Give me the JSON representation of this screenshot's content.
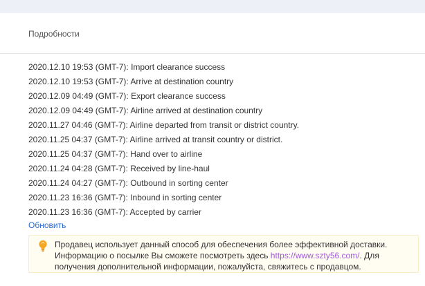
{
  "details": {
    "title": "Подробности"
  },
  "events": [
    "2020.12.10 19:53 (GMT-7): Import clearance success",
    "2020.12.10 19:53 (GMT-7): Arrive at destination country",
    "2020.12.09 04:49 (GMT-7): Export clearance success",
    "2020.12.09 04:49 (GMT-7): Airline arrived at destination country",
    "2020.11.27 04:46 (GMT-7): Airline departed from transit or district country.",
    "2020.11.25 04:37 (GMT-7): Airline arrived at transit country or district.",
    "2020.11.25 04:37 (GMT-7): Hand over to airline",
    "2020.11.24 04:28 (GMT-7): Received by line-haul",
    "2020.11.24 04:27 (GMT-7): Outbound in sorting center",
    "2020.11.23 16:36 (GMT-7): Inbound in sorting center",
    "2020.11.23 16:36 (GMT-7): Accepted by carrier"
  ],
  "actions": {
    "refresh_label": "Обновить"
  },
  "notice": {
    "icon": "lightbulb-icon",
    "text_before": "Продавец использует данный способ для обеспечения более эффективной доставки. Информацию о посылке Вы сможете посмотреть здесь ",
    "link_text": "https://www.szty56.com/",
    "text_after": ". Для получения дополнительной информации, пожалуйста, свяжитесь с продавцом."
  },
  "colors": {
    "link": "#2b6bd1",
    "notice_link": "#a05ad8",
    "bulb": "#f5a623",
    "notice_background": "#fffdf2"
  }
}
